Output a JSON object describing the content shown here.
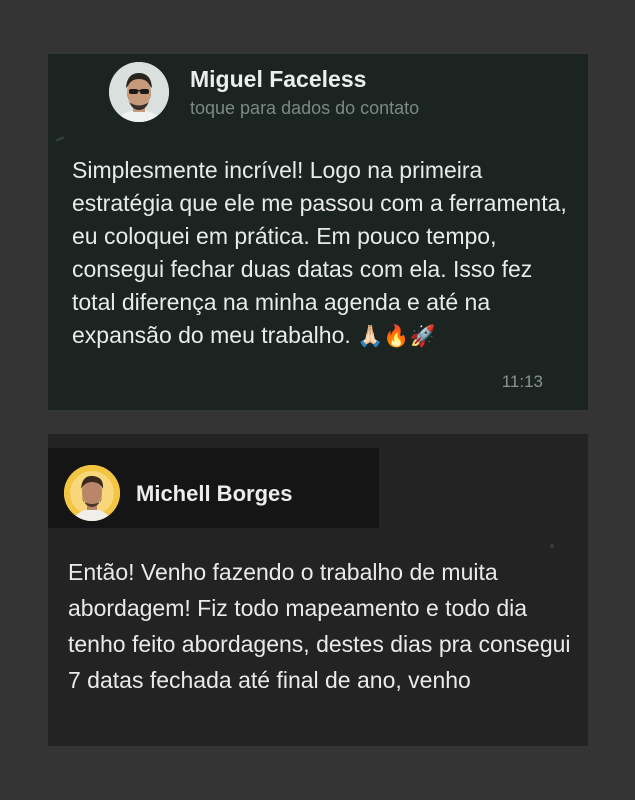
{
  "messages": [
    {
      "name": "Miguel Faceless",
      "subtitle": "toque para dados do contato",
      "text": "Simplesmente incrível! Logo na primeira estratégia que ele me passou com a ferramenta, eu coloquei em prática. Em pouco tempo, consegui fechar duas datas com ela. Isso fez total diferença na minha agenda e até na expansão do meu trabalho.",
      "emojis": "🙏🏻🔥🚀",
      "time": "11:13"
    },
    {
      "name": "Michell Borges",
      "text": "Então! Venho fazendo o trabalho de muita abordagem! Fiz todo mapeamento e todo dia tenho feito abordagens, destes dias pra  consegui 7 datas fechada até final de ano,  venho"
    }
  ],
  "colors": {
    "page_bg": "#343434",
    "card1_bg": "#1b2421",
    "card2_bg": "#232323",
    "text": "#e9eaea",
    "muted": "#7d8784"
  },
  "icons": [
    "avatar-miguel-icon",
    "avatar-michell-icon"
  ]
}
